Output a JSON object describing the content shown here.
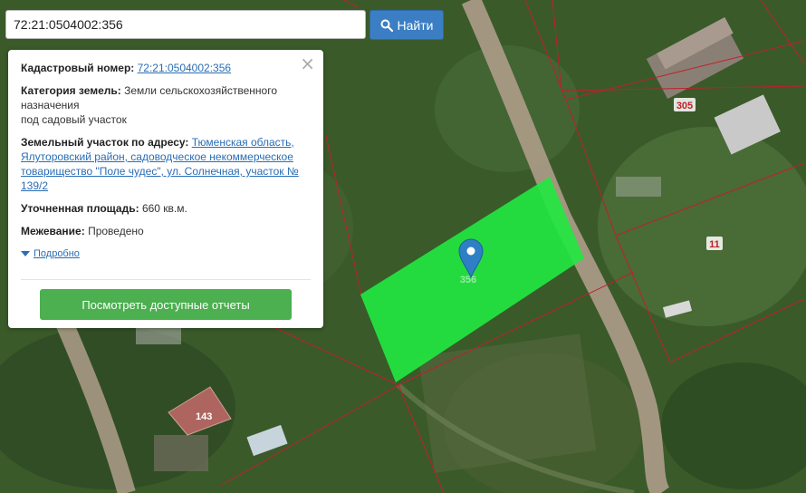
{
  "search": {
    "value": "72:21:0504002:356",
    "button_label": "Найти",
    "button_icon": "search-icon"
  },
  "info": {
    "cadastral_label": "Кадастровый номер:",
    "cadastral_value": "72:21:0504002:356",
    "category_label": "Категория земель:",
    "category_value_line1": "Земли сельскохозяйственного",
    "category_value_line2": "назначения",
    "category_value_line3": "под садовый участок",
    "address_label": "Земельный участок по адресу:",
    "address_value": "Тюменская область, Ялуторовский район, садоводческое некоммерческое товарищество \"Поле чудес\", ул. Солнечная, участок № 139/2",
    "area_label": "Уточненная площадь:",
    "area_value": "660 кв.м.",
    "survey_label": "Межевание:",
    "survey_value": "Проведено",
    "more_label": "Подробно",
    "report_button": "Посмотреть доступные отчеты",
    "close_icon": "close-icon"
  },
  "map": {
    "plot_labels": [
      "305",
      "11",
      "356",
      "143"
    ],
    "selected_color": "#22e640",
    "boundary_color": "#c0202a"
  }
}
